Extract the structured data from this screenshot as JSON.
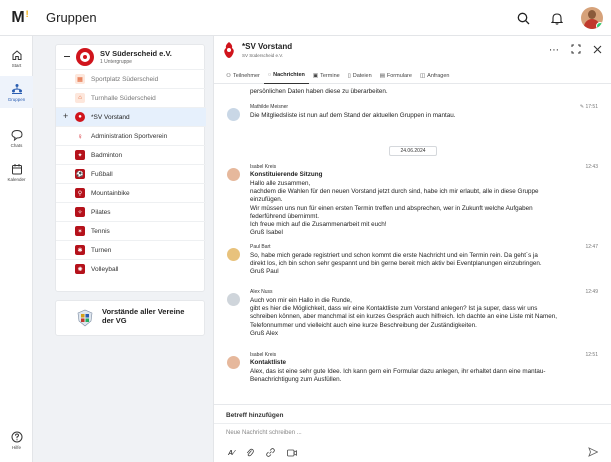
{
  "app": {
    "title": "Gruppen",
    "logo_text": "M",
    "logo_accent": "!"
  },
  "nav": {
    "items": [
      {
        "label": "Start",
        "icon": "home-icon"
      },
      {
        "label": "Gruppen",
        "icon": "groups-icon",
        "active": true
      },
      {
        "label": "Chats",
        "icon": "chat-icon"
      },
      {
        "label": "Kalender",
        "icon": "calendar-icon"
      }
    ],
    "help_label": "Hilfe"
  },
  "group": {
    "name": "SV Süderscheid e.V.",
    "sub": "1 Untergruppe",
    "items": [
      {
        "label": "Sportplatz Süderscheid",
        "icon": "field-icon",
        "color": "#e05a2a",
        "muted": true
      },
      {
        "label": "Turnhalle Süderscheid",
        "icon": "gym-icon",
        "color": "#e05a2a",
        "muted": true
      },
      {
        "label": "*SV Vorstand",
        "icon": "club-logo-icon",
        "color": "#d0141c",
        "active": true
      },
      {
        "label": "Administration Sportverein",
        "icon": "admin-icon",
        "color": "#d0141c"
      },
      {
        "label": "Badminton",
        "icon": "badminton-icon",
        "color": "#b5121b"
      },
      {
        "label": "Fußball",
        "icon": "football-icon",
        "color": "#b5121b"
      },
      {
        "label": "Mountainbike",
        "icon": "bike-icon",
        "color": "#b5121b"
      },
      {
        "label": "Pilates",
        "icon": "pilates-icon",
        "color": "#b5121b"
      },
      {
        "label": "Tennis",
        "icon": "tennis-icon",
        "color": "#b5121b"
      },
      {
        "label": "Turnen",
        "icon": "gymnastics-icon",
        "color": "#b5121b"
      },
      {
        "label": "Volleyball",
        "icon": "volleyball-icon",
        "color": "#b5121b"
      }
    ]
  },
  "vorstaende": {
    "title": "Vorstände aller Vereine der VG"
  },
  "chat": {
    "title": "*SV Vorstand",
    "subtitle": "SV Süderscheid e.V.",
    "tabs": [
      {
        "label": "Teilnehmer",
        "icon": "people-icon"
      },
      {
        "label": "Nachrichten",
        "icon": "message-icon",
        "active": true
      },
      {
        "label": "Termine",
        "icon": "calendar-icon"
      },
      {
        "label": "Dateien",
        "icon": "file-icon"
      },
      {
        "label": "Formulare",
        "icon": "form-icon"
      },
      {
        "label": "Anfragen",
        "icon": "request-icon"
      }
    ],
    "top_partial": "persönlichen Daten haben diese zu überarbeiten.",
    "date_divider": "24.06.2024",
    "messages": [
      {
        "name": "Mathilde Meisner",
        "time": "17:51",
        "lines": [
          "Die Mitgliedsliste ist nun auf dem Stand der aktuellen Gruppen in mantau."
        ]
      },
      {
        "name": "Isabel Kreis",
        "time": "12:43",
        "subject": "Konstituierende Sitzung",
        "lines": [
          "Hallo alle zusammen,",
          "nachdem die Wahlen für den neuen Vorstand jetzt durch sind, habe ich mir erlaubt, alle in diese Gruppe",
          "einzufügen.",
          "Wir müssen uns nun für einen ersten Termin treffen und absprechen, wer in Zukunft welche Aufgaben",
          "federführend übernimmt.",
          "Ich freue mich auf die Zusammenarbeit mit euch!",
          "Gruß Isabel"
        ]
      },
      {
        "name": "Paul Bart",
        "time": "12:47",
        "lines": [
          "So, habe mich gerade registriert und schon kommt die erste Nachricht und ein Termin rein. Da geht´s ja",
          "direkt los, ich bin schon sehr gespannt und bin gerne bereit mich aktiv bei Eventplanungen einzubringen.",
          "Gruß Paul"
        ]
      },
      {
        "name": "Alex Nuss",
        "time": "12:49",
        "lines": [
          "Auch von mir ein Hallo in die Runde,",
          "gibt es hier die Möglichkeit, dass wir eine Kontaktliste zum Vorstand anlegen? Ist ja super, dass wir uns",
          "schreiben können, aber manchmal ist ein kurzes Gespräch auch hilfreich. Ich dachte an eine Liste mit Namen,",
          "Telefonnummer und vielleicht auch eine kurze Beschreibung der Zuständigkeiten.",
          "Gruß Alex"
        ]
      },
      {
        "name": "Isabel Kreis",
        "time": "12:51",
        "subject": "Kontaktliste",
        "lines": [
          "Alex, das ist eine sehr gute Idee. Ich kann gern ein Formular dazu anlegen, ihr erhaltet dann eine mantau-",
          "Benachrichtigung zum Ausfüllen."
        ]
      }
    ],
    "composer": {
      "subject_label": "Betreff hinzufügen",
      "placeholder": "Neue Nachricht schreiben ..."
    }
  }
}
